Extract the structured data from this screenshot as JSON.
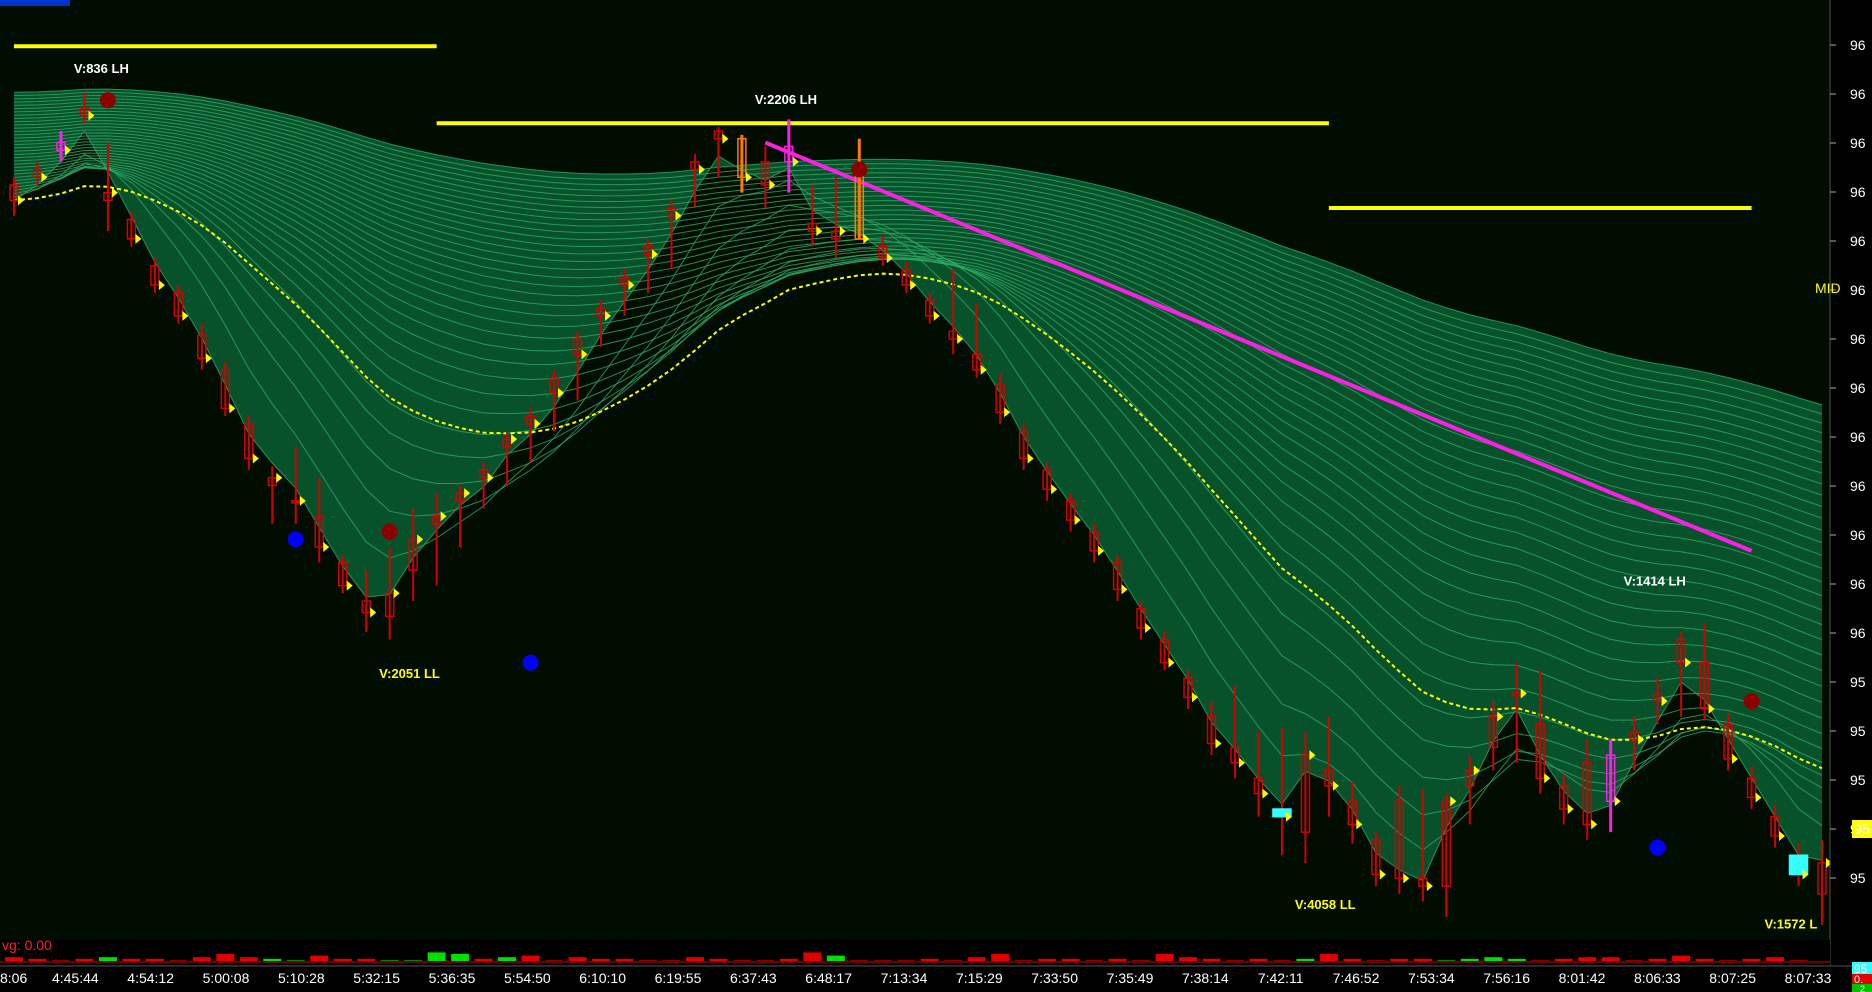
{
  "colors": {
    "background": "#000d00",
    "ribbon": "#0f8c4e",
    "grid_line": "#2eaa66",
    "level_line": "#ffff00",
    "trend_line": "#ff1ee6",
    "candle": "#d40000",
    "highlight_candle": "#ff7a00",
    "cyan_candle": "#33ffff",
    "swing_high_dot": "#8b0000",
    "swing_low_dot": "#0000ff",
    "volume_up": "#00e000",
    "volume_down": "#e00000"
  },
  "price_axis_label": "96",
  "mid_label": "MID",
  "avg_label": "vg: 0.00",
  "top_left_badge": "",
  "bottom_right_badges": {
    "top": "95",
    "mid": "0.",
    "bot": "2"
  },
  "annotations": [
    {
      "text": "V:836 LH",
      "color": "#ffffff"
    },
    {
      "text": "V:2206 LH",
      "color": "#ffffff"
    },
    {
      "text": "V:2051 LL",
      "color": "#ffff00"
    },
    {
      "text": "V:4058 LL",
      "color": "#ffff00"
    },
    {
      "text": "V:1414 LH",
      "color": "#ffffff"
    },
    {
      "text": "V:1572 L",
      "color": "#ffff00"
    }
  ],
  "chart_data": {
    "type": "candlestick",
    "x_ticks": [
      "8:06",
      "4:45:44",
      "4:54:12",
      "5:00:08",
      "5:10:28",
      "5:32:15",
      "5:36:35",
      "5:54:50",
      "6:10:10",
      "6:19:55",
      "6:37:43",
      "6:48:17",
      "7:13:34",
      "7:15:29",
      "7:33:50",
      "7:35:49",
      "7:38:14",
      "7:42:11",
      "7:46:52",
      "7:53:34",
      "7:56:16",
      "8:01:42",
      "8:06:33",
      "8:07:25",
      "8:07:33"
    ],
    "y_ticks": [
      "96",
      "96",
      "96",
      "96",
      "96",
      "96",
      "96",
      "96",
      "96",
      "96",
      "96",
      "96",
      "96",
      "95",
      "95",
      "95",
      "95",
      "95"
    ],
    "current_price_label": "95",
    "levels": [
      {
        "from_bar": 0,
        "to_bar": 18,
        "price": 96.6
      },
      {
        "from_bar": 18,
        "to_bar": 56,
        "price": 96.4
      },
      {
        "from_bar": 56,
        "to_bar": 74,
        "price": 96.18
      }
    ],
    "trend_line": {
      "from_bar": 32,
      "from_price": 96.35,
      "to_bar": 74,
      "to_price": 95.29
    },
    "bars": [
      {
        "o": 96.24,
        "h": 96.26,
        "l": 96.16,
        "c": 96.2
      },
      {
        "o": 96.28,
        "h": 96.3,
        "l": 96.24,
        "c": 96.26
      },
      {
        "o": 96.35,
        "h": 96.38,
        "l": 96.3,
        "c": 96.33
      },
      {
        "o": 96.44,
        "h": 96.48,
        "l": 96.4,
        "c": 96.42
      },
      {
        "o": 96.2,
        "h": 96.35,
        "l": 96.12,
        "c": 96.22
      },
      {
        "o": 96.15,
        "h": 96.17,
        "l": 96.08,
        "c": 96.1
      },
      {
        "o": 96.03,
        "h": 96.05,
        "l": 95.96,
        "c": 95.98
      },
      {
        "o": 95.96,
        "h": 95.98,
        "l": 95.88,
        "c": 95.9
      },
      {
        "o": 95.85,
        "h": 95.88,
        "l": 95.76,
        "c": 95.79
      },
      {
        "o": 95.76,
        "h": 95.78,
        "l": 95.64,
        "c": 95.66
      },
      {
        "o": 95.62,
        "h": 95.64,
        "l": 95.5,
        "c": 95.53
      },
      {
        "o": 95.46,
        "h": 95.51,
        "l": 95.36,
        "c": 95.48
      },
      {
        "o": 95.42,
        "h": 95.56,
        "l": 95.36,
        "c": 95.42
      },
      {
        "o": 95.38,
        "h": 95.48,
        "l": 95.26,
        "c": 95.3
      },
      {
        "o": 95.26,
        "h": 95.28,
        "l": 95.18,
        "c": 95.2
      },
      {
        "o": 95.16,
        "h": 95.24,
        "l": 95.08,
        "c": 95.13
      },
      {
        "o": 95.12,
        "h": 95.3,
        "l": 95.06,
        "c": 95.18
      },
      {
        "o": 95.24,
        "h": 95.4,
        "l": 95.16,
        "c": 95.32
      },
      {
        "o": 95.36,
        "h": 95.44,
        "l": 95.2,
        "c": 95.38
      },
      {
        "o": 95.42,
        "h": 95.46,
        "l": 95.3,
        "c": 95.44
      },
      {
        "o": 95.5,
        "h": 95.52,
        "l": 95.4,
        "c": 95.48
      },
      {
        "o": 95.56,
        "h": 95.6,
        "l": 95.46,
        "c": 95.58
      },
      {
        "o": 95.64,
        "h": 95.66,
        "l": 95.52,
        "c": 95.62
      },
      {
        "o": 95.74,
        "h": 95.76,
        "l": 95.6,
        "c": 95.7
      },
      {
        "o": 95.84,
        "h": 95.86,
        "l": 95.68,
        "c": 95.8
      },
      {
        "o": 95.92,
        "h": 95.94,
        "l": 95.82,
        "c": 95.9
      },
      {
        "o": 96.0,
        "h": 96.02,
        "l": 95.9,
        "c": 95.98
      },
      {
        "o": 96.08,
        "h": 96.1,
        "l": 95.96,
        "c": 96.06
      },
      {
        "o": 96.18,
        "h": 96.2,
        "l": 96.02,
        "c": 96.16
      },
      {
        "o": 96.3,
        "h": 96.32,
        "l": 96.18,
        "c": 96.28
      },
      {
        "o": 96.38,
        "h": 96.39,
        "l": 96.26,
        "c": 96.36
      },
      {
        "o": 96.36,
        "h": 96.37,
        "l": 96.22,
        "c": 96.26
      },
      {
        "o": 96.3,
        "h": 96.34,
        "l": 96.18,
        "c": 96.24
      },
      {
        "o": 96.34,
        "h": 96.41,
        "l": 96.22,
        "c": 96.3
      },
      {
        "o": 96.14,
        "h": 96.24,
        "l": 96.08,
        "c": 96.12
      },
      {
        "o": 96.1,
        "h": 96.26,
        "l": 96.05,
        "c": 96.12
      },
      {
        "o": 96.28,
        "h": 96.36,
        "l": 96.1,
        "c": 96.1
      },
      {
        "o": 96.08,
        "h": 96.11,
        "l": 96.03,
        "c": 96.05
      },
      {
        "o": 96.02,
        "h": 96.04,
        "l": 95.96,
        "c": 95.98
      },
      {
        "o": 95.94,
        "h": 95.96,
        "l": 95.88,
        "c": 95.9
      },
      {
        "o": 95.86,
        "h": 96.02,
        "l": 95.8,
        "c": 95.84
      },
      {
        "o": 95.8,
        "h": 95.93,
        "l": 95.74,
        "c": 95.76
      },
      {
        "o": 95.72,
        "h": 95.75,
        "l": 95.62,
        "c": 95.65
      },
      {
        "o": 95.6,
        "h": 95.62,
        "l": 95.5,
        "c": 95.53
      },
      {
        "o": 95.5,
        "h": 95.52,
        "l": 95.42,
        "c": 95.45
      },
      {
        "o": 95.42,
        "h": 95.44,
        "l": 95.34,
        "c": 95.37
      },
      {
        "o": 95.34,
        "h": 95.36,
        "l": 95.26,
        "c": 95.29
      },
      {
        "o": 95.26,
        "h": 95.28,
        "l": 95.16,
        "c": 95.19
      },
      {
        "o": 95.14,
        "h": 95.16,
        "l": 95.06,
        "c": 95.09
      },
      {
        "o": 95.06,
        "h": 95.08,
        "l": 94.98,
        "c": 95.0
      },
      {
        "o": 94.96,
        "h": 94.98,
        "l": 94.88,
        "c": 94.91
      },
      {
        "o": 94.86,
        "h": 94.9,
        "l": 94.76,
        "c": 94.79
      },
      {
        "o": 94.78,
        "h": 94.94,
        "l": 94.7,
        "c": 94.74
      },
      {
        "o": 94.7,
        "h": 94.82,
        "l": 94.6,
        "c": 94.66
      },
      {
        "o": 94.62,
        "h": 94.83,
        "l": 94.5,
        "c": 94.6
      },
      {
        "o": 94.56,
        "h": 94.82,
        "l": 94.48,
        "c": 94.76
      },
      {
        "o": 94.72,
        "h": 94.86,
        "l": 94.6,
        "c": 94.68
      },
      {
        "o": 94.64,
        "h": 94.69,
        "l": 94.53,
        "c": 94.58
      },
      {
        "o": 94.54,
        "h": 94.56,
        "l": 94.42,
        "c": 94.45
      },
      {
        "o": 94.64,
        "h": 94.68,
        "l": 94.4,
        "c": 94.44
      },
      {
        "o": 94.44,
        "h": 94.67,
        "l": 94.38,
        "c": 94.42
      },
      {
        "o": 94.42,
        "h": 94.66,
        "l": 94.34,
        "c": 94.64
      },
      {
        "o": 94.68,
        "h": 94.76,
        "l": 94.58,
        "c": 94.72
      },
      {
        "o": 94.78,
        "h": 94.9,
        "l": 94.72,
        "c": 94.86
      },
      {
        "o": 94.92,
        "h": 95.0,
        "l": 94.74,
        "c": 94.92
      },
      {
        "o": 94.84,
        "h": 94.98,
        "l": 94.66,
        "c": 94.7
      },
      {
        "o": 94.68,
        "h": 94.71,
        "l": 94.58,
        "c": 94.62
      },
      {
        "o": 94.74,
        "h": 94.8,
        "l": 94.54,
        "c": 94.58
      },
      {
        "o": 94.76,
        "h": 94.8,
        "l": 94.56,
        "c": 94.64
      },
      {
        "o": 94.82,
        "h": 94.86,
        "l": 94.72,
        "c": 94.8
      },
      {
        "o": 94.92,
        "h": 94.96,
        "l": 94.84,
        "c": 94.9
      },
      {
        "o": 95.06,
        "h": 95.08,
        "l": 94.86,
        "c": 95.0
      },
      {
        "o": 95.0,
        "h": 95.1,
        "l": 94.85,
        "c": 94.88
      },
      {
        "o": 94.84,
        "h": 94.87,
        "l": 94.72,
        "c": 94.75
      },
      {
        "o": 94.7,
        "h": 94.73,
        "l": 94.62,
        "c": 94.65
      },
      {
        "o": 94.6,
        "h": 94.63,
        "l": 94.52,
        "c": 94.55
      },
      {
        "o": 94.5,
        "h": 94.53,
        "l": 94.42,
        "c": 94.45
      },
      {
        "o": 94.4,
        "h": 94.54,
        "l": 94.32,
        "c": 94.48
      }
    ],
    "volume": [
      3,
      2,
      1,
      2,
      3,
      2,
      2,
      1,
      3,
      5,
      3,
      2,
      1,
      4,
      2,
      2,
      1,
      1,
      6,
      5,
      2,
      3,
      4,
      1,
      3,
      2,
      2,
      1,
      1,
      3,
      2,
      1,
      1,
      2,
      6,
      4,
      1,
      1,
      1,
      2,
      1,
      3,
      5,
      1,
      2,
      2,
      1,
      2,
      1,
      5,
      3,
      2,
      1,
      2,
      1,
      2,
      5,
      2,
      1,
      2,
      2,
      1,
      2,
      3,
      2,
      1,
      2,
      3,
      3,
      1,
      2,
      4,
      2,
      1,
      2,
      3,
      1
    ]
  }
}
